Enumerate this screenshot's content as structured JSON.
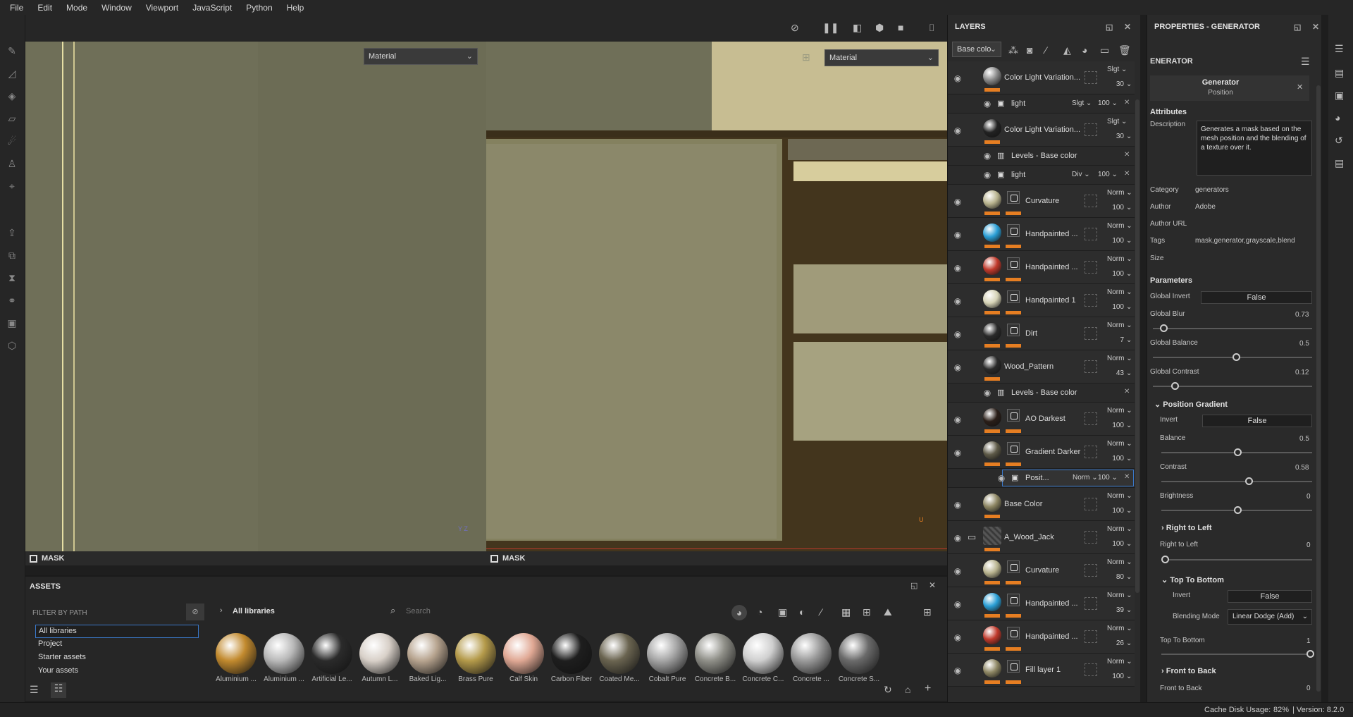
{
  "menu": [
    "File",
    "Edit",
    "Mode",
    "Window",
    "Viewport",
    "JavaScript",
    "Python",
    "Help"
  ],
  "viewport": {
    "left_dropdown": "Material",
    "right_dropdown": "Material",
    "left_bar": "MASK",
    "right_bar": "MASK",
    "axis_y": "Y",
    "axis_z": "Z",
    "axis_u": "U"
  },
  "layers": {
    "title": "LAYERS",
    "channel": "Base colo",
    "rows": [
      {
        "name": "Color Light Variation...",
        "blend": "Slgt",
        "opacity": "30",
        "thumb": "#888"
      },
      {
        "name": "light",
        "blend": "Slgt",
        "opacity": "100",
        "sub": true
      },
      {
        "name": "Color Light Variation...",
        "blend": "Slgt",
        "opacity": "30",
        "thumb": "#222"
      },
      {
        "name": "Levels - Base color",
        "sub": true
      },
      {
        "name": "light",
        "blend": "Div",
        "opacity": "100",
        "sub": true
      },
      {
        "name": "Curvature",
        "blend": "Norm",
        "opacity": "100",
        "thumb": "#b8b38e"
      },
      {
        "name": "Handpainted ...",
        "blend": "Norm",
        "opacity": "100",
        "thumb": "#2a9fd6"
      },
      {
        "name": "Handpainted ...",
        "blend": "Norm",
        "opacity": "100",
        "thumb": "#c0392b"
      },
      {
        "name": "Handpainted 1",
        "blend": "Norm",
        "opacity": "100",
        "thumb": "#d6d3b6"
      },
      {
        "name": "Dirt",
        "blend": "Norm",
        "opacity": "7",
        "thumb": "#2a2a2a"
      },
      {
        "name": "Wood_Pattern",
        "blend": "Norm",
        "opacity": "43",
        "thumb": "#2a2a2a"
      },
      {
        "name": "Levels - Base color",
        "sub": true
      },
      {
        "name": "AO Darkest",
        "blend": "Norm",
        "opacity": "100",
        "thumb": "#2a1e18"
      },
      {
        "name": "Gradient Darker",
        "blend": "Norm",
        "opacity": "100",
        "thumb": "#5e5a48"
      },
      {
        "name": "Posit...",
        "blend": "Norm",
        "opacity": "100",
        "sub": true,
        "selected": true
      },
      {
        "name": "Base Color",
        "blend": "Norm",
        "opacity": "100",
        "thumb": "#8d8663"
      },
      {
        "name": "A_Wood_Jack",
        "blend": "Norm",
        "opacity": "100",
        "folder": true
      },
      {
        "name": "Curvature",
        "blend": "Norm",
        "opacity": "80",
        "thumb": "#b8b38e"
      },
      {
        "name": "Handpainted ...",
        "blend": "Norm",
        "opacity": "39",
        "thumb": "#2a9fd6"
      },
      {
        "name": "Handpainted ...",
        "blend": "Norm",
        "opacity": "26",
        "thumb": "#c0392b"
      },
      {
        "name": "Fill layer 1",
        "blend": "Norm",
        "opacity": "100",
        "thumb": "#8d8663"
      }
    ]
  },
  "properties": {
    "title": "PROPERTIES - GENERATOR",
    "subtitle": "ENERATOR",
    "card_title": "Generator",
    "card_sub": "Position",
    "attributes_label": "Attributes",
    "description_label": "Description",
    "description": "Generates a mask based on the mesh position and the blending of a texture over it.",
    "category_label": "Category",
    "category": "generators",
    "author_label": "Author",
    "author": "Adobe",
    "author_url_label": "Author URL",
    "tags_label": "Tags",
    "tags": "mask,generator,grayscale,blend",
    "size_label": "Size",
    "parameters_label": "Parameters",
    "global_invert_label": "Global Invert",
    "global_invert": "False",
    "global_blur_label": "Global Blur",
    "global_blur": "0.73",
    "global_balance_label": "Global Balance",
    "global_balance": "0.5",
    "global_contrast_label": "Global Contrast",
    "global_contrast": "0.12",
    "position_gradient_label": "Position Gradient",
    "invert_label": "Invert",
    "invert": "False",
    "balance_label": "Balance",
    "balance": "0.5",
    "contrast_label": "Contrast",
    "contrast": "0.58",
    "brightness_label": "Brightness",
    "brightness": "0",
    "right_to_left_section": "Right to Left",
    "right_to_left_label": "Right to Left",
    "right_to_left": "0",
    "top_to_bottom_section": "Top To Bottom",
    "invert2_label": "Invert",
    "invert2": "False",
    "blending_mode_label": "Blending Mode",
    "blending_mode": "Linear Dodge (Add)",
    "top_to_bottom_label": "Top To Bottom",
    "top_to_bottom": "1",
    "front_to_back_section": "Front to Back",
    "front_to_back_label": "Front to Back",
    "front_to_back": "0"
  },
  "assets": {
    "title": "ASSETS",
    "filter_label": "FILTER BY PATH",
    "tree": [
      "All libraries",
      "Project",
      "Starter assets",
      "Your assets"
    ],
    "breadcrumb": "All libraries",
    "search_placeholder": "Search",
    "items": [
      {
        "name": "Aluminium ...",
        "color": "#c28a2e"
      },
      {
        "name": "Aluminium ...",
        "color": "#b9b9b9"
      },
      {
        "name": "Artificial Le...",
        "color": "#2b2b2b"
      },
      {
        "name": "Autumn L...",
        "color": "#d8d0c8"
      },
      {
        "name": "Baked Lig...",
        "color": "#b7a48f"
      },
      {
        "name": "Brass Pure",
        "color": "#b49a4a"
      },
      {
        "name": "Calf Skin",
        "color": "#e0a894"
      },
      {
        "name": "Carbon Fiber",
        "color": "#1e1e1e"
      },
      {
        "name": "Coated Me...",
        "color": "#6a6450"
      },
      {
        "name": "Cobalt Pure",
        "color": "#a5a5a5"
      },
      {
        "name": "Concrete B...",
        "color": "#8f8f88"
      },
      {
        "name": "Concrete C...",
        "color": "#cfcfcf"
      },
      {
        "name": "Concrete ...",
        "color": "#9a9a9a"
      },
      {
        "name": "Concrete S...",
        "color": "#6a6a6a"
      }
    ]
  },
  "status": {
    "cache_label": "Cache Disk Usage:",
    "cache_value": "82%",
    "version": "| Version: 8.2.0"
  }
}
